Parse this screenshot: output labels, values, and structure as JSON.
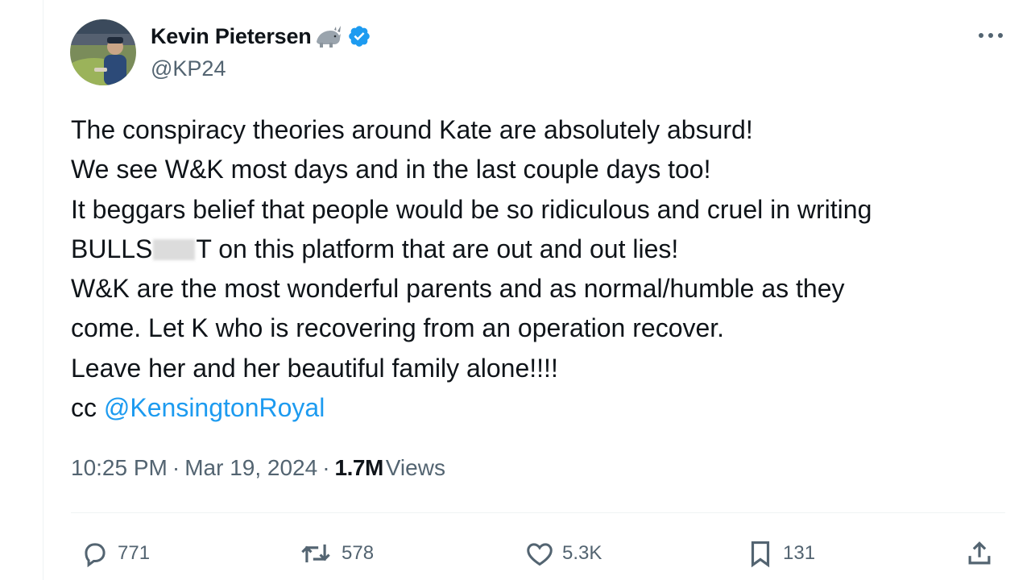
{
  "author": {
    "display_name": "Kevin Pietersen",
    "emoji_icon": "rhino-icon",
    "verified_icon": "verified-badge-icon",
    "handle": "@KP24"
  },
  "tweet": {
    "lines": [
      "The conspiracy theories around Kate are absolutely absurd!",
      "We see W&K most days and in the last couple days too!",
      "It beggars belief that people would be so ridiculous and cruel in writing",
      "T on this platform that are out and out lies!",
      "W&K are the most wonderful parents and as normal/humble as they",
      "come. Let K who is recovering from an operation recover.",
      "Leave her and her beautiful family alone!!!!"
    ],
    "censored_prefix": "BULLS",
    "cc_prefix": "cc",
    "mention": "@KensingtonRoyal"
  },
  "meta": {
    "time": "10:25 PM",
    "separator": "·",
    "date": "Mar 19, 2024",
    "views_count": "1.7M",
    "views_label": "Views"
  },
  "actions": {
    "replies": "771",
    "reposts": "578",
    "likes": "5.3K",
    "bookmarks": "131"
  },
  "colors": {
    "accent": "#1d9bf0",
    "text_primary": "#0f1419",
    "text_secondary": "#536471",
    "divider": "#eff3f4"
  }
}
